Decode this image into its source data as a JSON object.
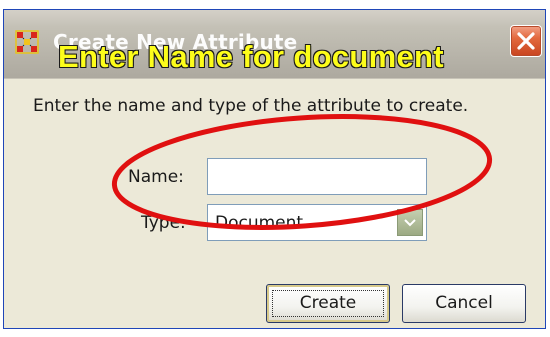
{
  "window": {
    "title": "Create New Attribute",
    "close_icon": "close-icon"
  },
  "annotation": {
    "banner": "Enter Name for document",
    "highlight_color": "#e01010",
    "banner_color": "#fdfd1a"
  },
  "dialog": {
    "instruction": "Enter the name and type of the attribute to create.",
    "name_label": "Name:",
    "name_value": "",
    "type_label": "Type:",
    "type_value": "Document",
    "create_label": "Create",
    "cancel_label": "Cancel"
  }
}
